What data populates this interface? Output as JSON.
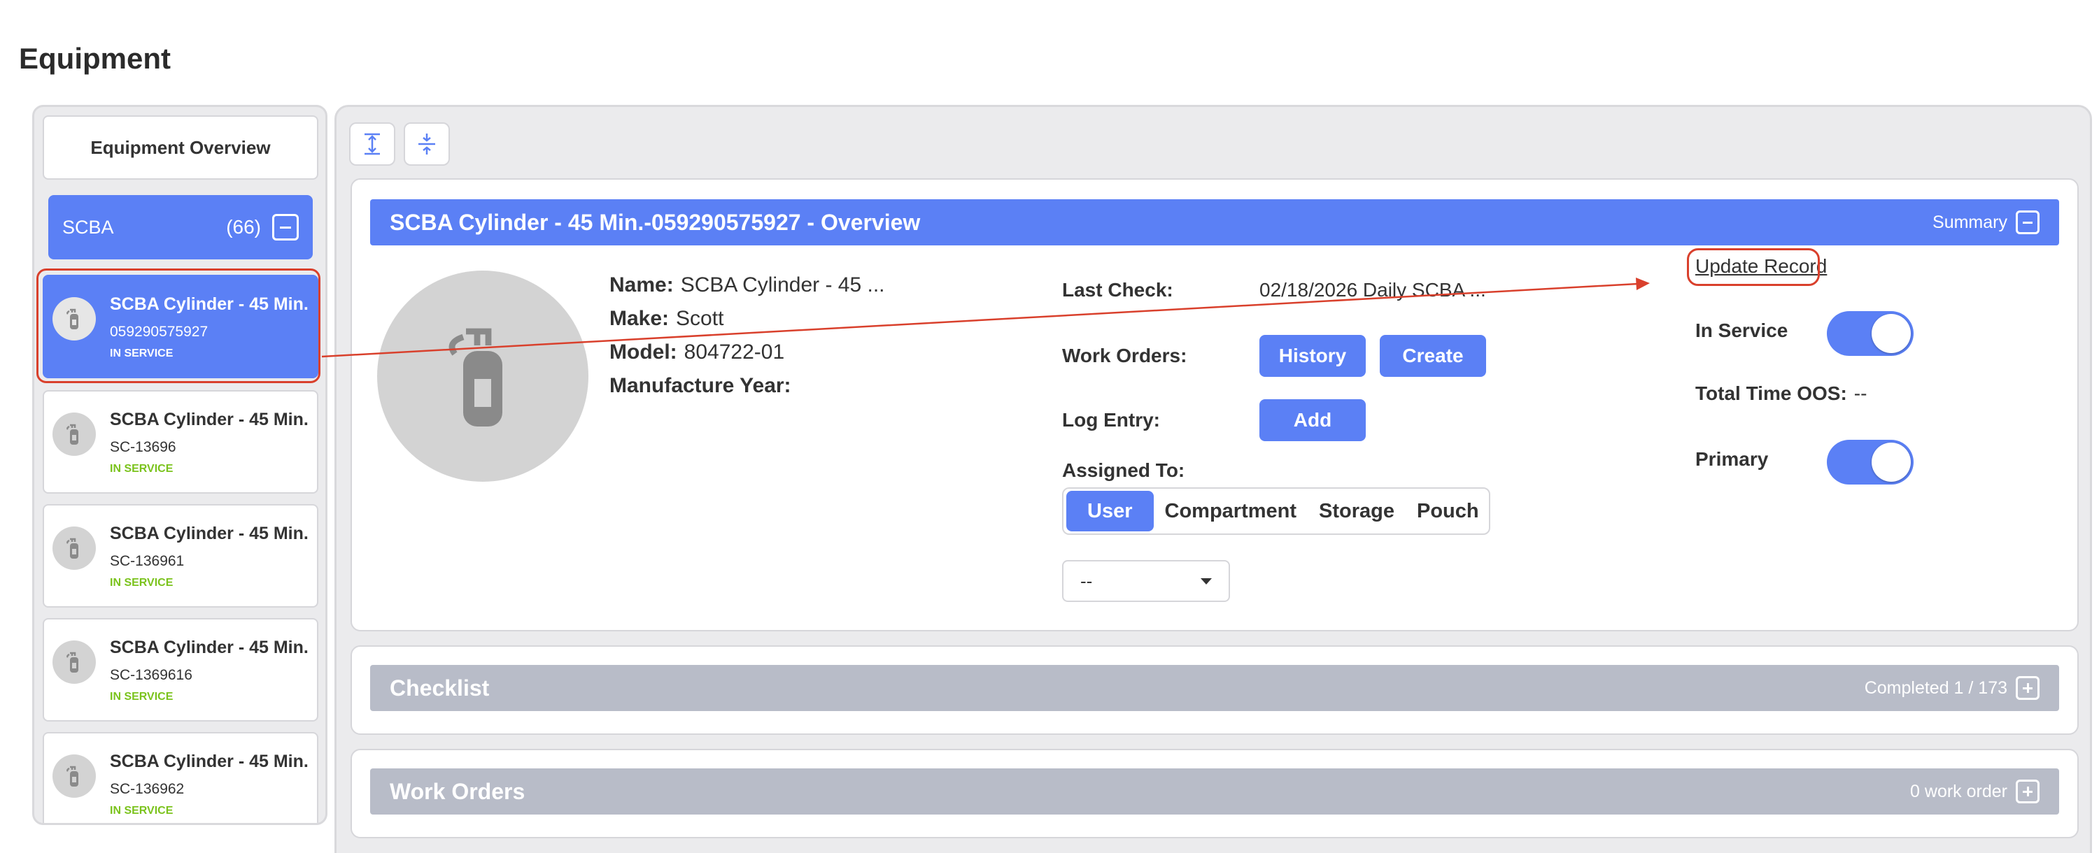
{
  "page": {
    "title": "Equipment"
  },
  "sidebar": {
    "overview_label": "Equipment Overview",
    "group": {
      "name": "SCBA",
      "count": "(66)"
    },
    "items": [
      {
        "title": "SCBA Cylinder - 45 Min.",
        "serial": "059290575927",
        "status": "IN SERVICE",
        "selected": true
      },
      {
        "title": "SCBA Cylinder - 45 Min.",
        "serial": "SC-13696",
        "status": "IN SERVICE"
      },
      {
        "title": "SCBA Cylinder - 45 Min.",
        "serial": "SC-136961",
        "status": "IN SERVICE"
      },
      {
        "title": "SCBA Cylinder - 45 Min.",
        "serial": "SC-1369616",
        "status": "IN SERVICE"
      },
      {
        "title": "SCBA Cylinder - 45 Min.",
        "serial": "SC-136962",
        "status": "IN SERVICE"
      }
    ]
  },
  "overview": {
    "header_title": "SCBA Cylinder - 45 Min.-059290575927 - Overview",
    "header_right": "Summary",
    "name_label": "Name:",
    "name_value": "SCBA Cylinder - 45 ...",
    "make_label": "Make:",
    "make_value": "Scott",
    "model_label": "Model:",
    "model_value": "804722-01",
    "year_label": "Manufacture Year:",
    "year_value": "",
    "last_check_label": "Last Check:",
    "last_check_value": "02/18/2026 Daily SCBA ...",
    "work_orders_label": "Work Orders:",
    "history_btn": "History",
    "create_btn": "Create",
    "log_entry_label": "Log Entry:",
    "add_btn": "Add",
    "assigned_label": "Assigned To:",
    "assign_options": [
      "User",
      "Compartment",
      "Storage",
      "Pouch"
    ],
    "assign_selected": "User",
    "dropdown_value": "--",
    "update_record": "Update Record",
    "in_service_label": "In Service",
    "in_service_on": true,
    "total_oos_label": "Total Time OOS:",
    "total_oos_value": "--",
    "primary_label": "Primary",
    "primary_on": true
  },
  "checklist": {
    "title": "Checklist",
    "right": "Completed 1 / 173"
  },
  "work_orders": {
    "title": "Work Orders",
    "right": "0 work order"
  },
  "colors": {
    "accent": "#5b80f5",
    "status_green": "#7bc31d",
    "annotation_red": "#d9402c",
    "collapsed_header": "#b8bcc8"
  },
  "icons": [
    "fire-extinguisher-icon",
    "expand-all-icon",
    "collapse-all-icon",
    "minus-square-icon",
    "plus-square-icon",
    "caret-down-icon"
  ]
}
